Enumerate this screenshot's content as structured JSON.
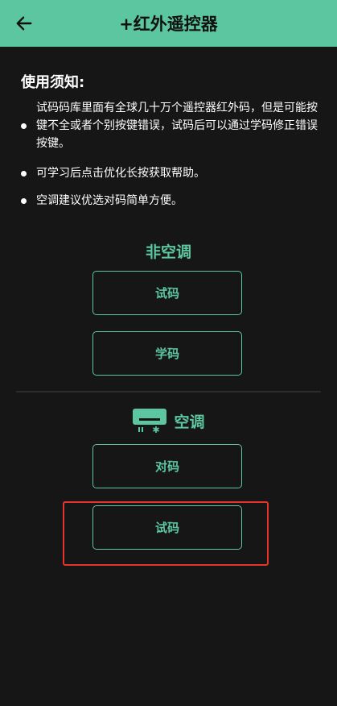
{
  "header": {
    "title": "+红外遥控器",
    "back_icon": "arrow-left-icon"
  },
  "notice": {
    "title": "使用须知:",
    "items": [
      "试码码库里面有全球几十万个遥控器红外码，但是可能按键不全或者个别按键错误，试码后可以通过学码修正错误按键。",
      "可学习后点击优化长按获取帮助。",
      "空调建议优选对码简单方便。"
    ]
  },
  "non_ac": {
    "title": "非空调",
    "try_code_label": "试码",
    "learn_code_label": "学码"
  },
  "ac": {
    "title": "空调",
    "icon": "air-conditioner-icon",
    "match_code_label": "对码",
    "try_code_label": "试码"
  },
  "colors": {
    "accent": "#5cc6a0",
    "background": "#161616",
    "highlight": "#e8332c"
  }
}
